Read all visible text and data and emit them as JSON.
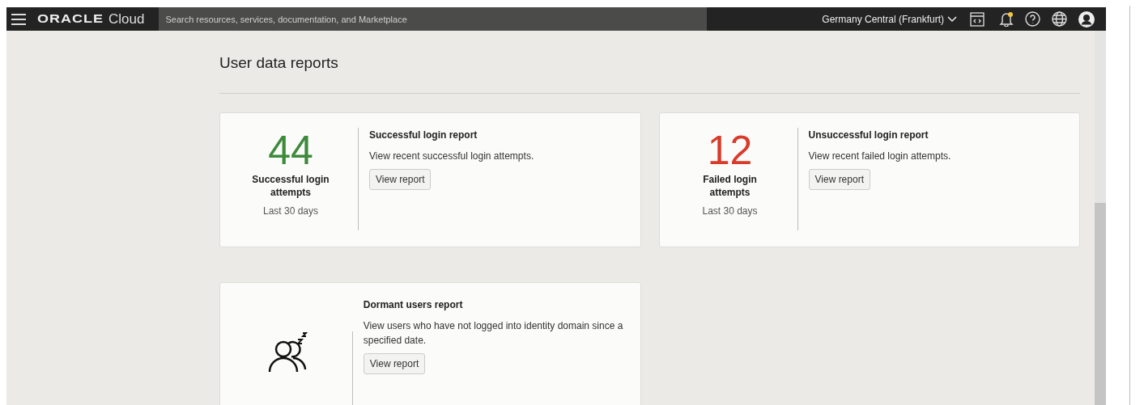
{
  "header": {
    "brand": "ORACLE",
    "product": "Cloud",
    "search": {
      "placeholder": "Search resources, services, documentation, and Marketplace"
    },
    "region": "Germany Central (Frankfurt)"
  },
  "page": {
    "title": "User data reports"
  },
  "reports": [
    {
      "kind": "count",
      "count": "44",
      "color": "#3d8a3a",
      "count_label": "Successful login attempts",
      "period": "Last 30 days",
      "title": "Successful login report",
      "description": "View recent successful login attempts.",
      "button": "View report"
    },
    {
      "kind": "count",
      "count": "12",
      "color": "#d93b2b",
      "count_label": "Failed login attempts",
      "period": "Last 30 days",
      "title": "Unsuccessful login report",
      "description": "View recent failed login attempts.",
      "button": "View report"
    },
    {
      "kind": "icon",
      "title": "Dormant users report",
      "description": "View users who have not logged into identity domain since a specified date.",
      "button": "View report"
    }
  ]
}
